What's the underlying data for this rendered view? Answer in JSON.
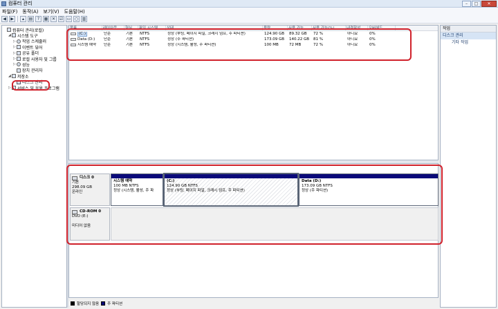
{
  "window": {
    "title": "컴퓨터 관리"
  },
  "menu": [
    "파일(F)",
    "동작(A)",
    "보기(V)",
    "도움말(H)"
  ],
  "tree": [
    {
      "label": "컴퓨터 관리(로컬)",
      "expander": "",
      "icon": "computer-icon",
      "indent": 0
    },
    {
      "label": "시스템 도구",
      "expander": "◢",
      "icon": "tools-icon",
      "indent": 1
    },
    {
      "label": "작업 스케줄러",
      "expander": "▷",
      "icon": "clock-icon",
      "indent": 2
    },
    {
      "label": "이벤트 뷰어",
      "expander": "▷",
      "icon": "event-icon",
      "indent": 2
    },
    {
      "label": "공유 폴더",
      "expander": "▷",
      "icon": "folder-icon",
      "indent": 2
    },
    {
      "label": "로컬 사용자 및 그룹",
      "expander": "▷",
      "icon": "users-icon",
      "indent": 2
    },
    {
      "label": "성능",
      "expander": "▷",
      "icon": "performance-icon",
      "indent": 2
    },
    {
      "label": "장치 관리자",
      "expander": "",
      "icon": "device-icon",
      "indent": 2
    },
    {
      "label": "저장소",
      "expander": "◢",
      "icon": "storage-icon",
      "indent": 1
    },
    {
      "label": "디스크 관리",
      "expander": "",
      "icon": "disk-icon",
      "indent": 2
    },
    {
      "label": "서비스 및 응용 프로그램",
      "expander": "▷",
      "icon": "services-icon",
      "indent": 1
    }
  ],
  "list": {
    "columns": [
      "볼륨",
      "레이아웃",
      "형식",
      "파일 시스템",
      "상태",
      "용량",
      "사용 가능",
      "사용 가능(%)",
      "내결함성",
      "오버헤드"
    ],
    "rows": [
      [
        "(C:)",
        "단순",
        "기본",
        "NTFS",
        "정상 (부팅, 페이지 파일, 크래시 덤프, 주 파티션)",
        "124.90 GB",
        "89.32 GB",
        "72 %",
        "아니요",
        "0%"
      ],
      [
        "Data (D:)",
        "단순",
        "기본",
        "NTFS",
        "정상 (주 파티션)",
        "173.09 GB",
        "140.22 GB",
        "81 %",
        "아니요",
        "0%"
      ],
      [
        "시스템 예약",
        "단순",
        "기본",
        "NTFS",
        "정상 (시스템, 활성, 주 파티션)",
        "100 MB",
        "72 MB",
        "72 %",
        "아니요",
        "0%"
      ]
    ]
  },
  "disks": {
    "disk0": {
      "name": "디스크 0",
      "type": "기본",
      "size": "298.09 GB",
      "status": "온라인",
      "partitions": [
        {
          "name": "시스템 예약",
          "size": "100 MB NTFS",
          "status": "정상 (시스템, 활성, 주 파"
        },
        {
          "name": "(C:)",
          "size": "124.90 GB NTFS",
          "status": "정상 (부팅, 페이지 파일, 크래시 덤프, 주 파티션)"
        },
        {
          "name": "Data  (D:)",
          "size": "173.09 GB NTFS",
          "status": "정상 (주 파티션)"
        }
      ]
    },
    "cdrom0": {
      "name": "CD-ROM 0",
      "type": "DVD (E:)",
      "status": "미디어 없음"
    }
  },
  "legend": [
    {
      "label": "할당되지 않음",
      "color": "#000000"
    },
    {
      "label": "주 파티션",
      "color": "#0a0a7a"
    }
  ],
  "actions": {
    "header": "작업",
    "section": "디스크 관리",
    "more": "기타 작업"
  },
  "colors": {
    "accent": "#0a0a7a",
    "callout": "#d0202a",
    "selection": "#cfe3fb"
  }
}
